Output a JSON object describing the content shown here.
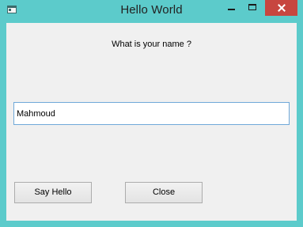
{
  "window": {
    "title": "Hello World",
    "controls": {
      "minimize": "minimize-icon",
      "maximize": "maximize-icon",
      "close": "close-icon"
    },
    "close_button_color": "#c7463f",
    "frame_color": "#5ccbcb"
  },
  "form": {
    "question": "What is your name ?",
    "name_value": "Mahmoud",
    "say_hello_label": "Say Hello",
    "close_label": "Close"
  }
}
